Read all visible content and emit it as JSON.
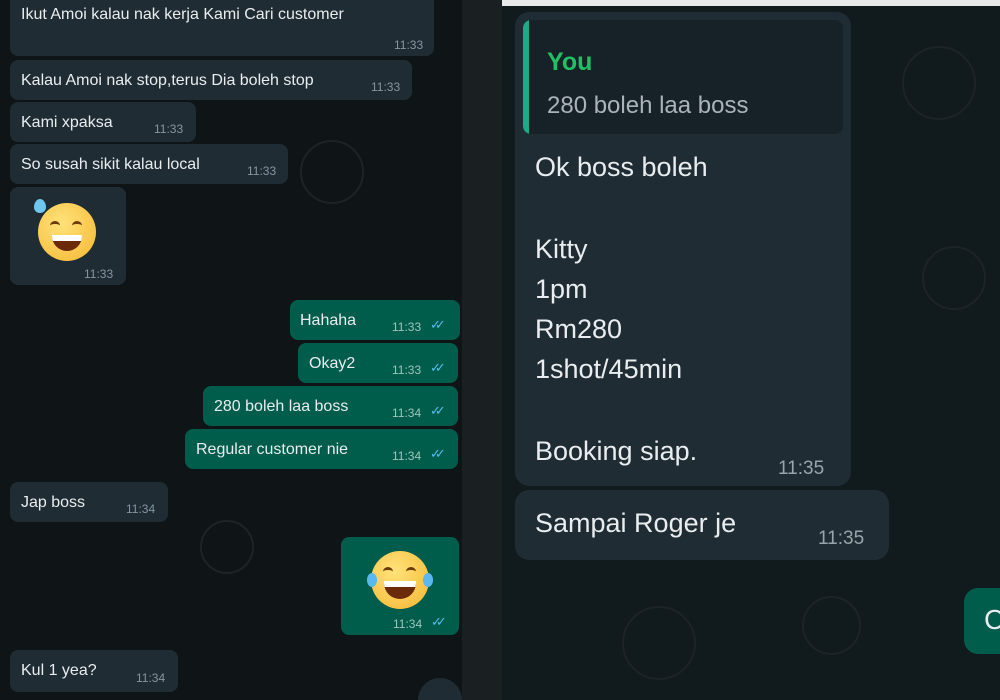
{
  "left_chat": {
    "messages": [
      {
        "text": "Ikut Amoi kalau nak kerja Kami Cari customer",
        "time": "11:33"
      },
      {
        "text": "Kalau Amoi nak stop,terus Dia boleh stop",
        "time": "11:33"
      },
      {
        "text": "Kami xpaksa",
        "time": "11:33"
      },
      {
        "text": "So susah sikit kalau local",
        "time": "11:33"
      },
      {
        "emoji": "sweat-smile-emoji",
        "time": "11:33"
      },
      {
        "text": "Hahaha",
        "time": "11:33"
      },
      {
        "text": "Okay2",
        "time": "11:33"
      },
      {
        "text": "280 boleh laa boss",
        "time": "11:34"
      },
      {
        "text": "Regular customer nie",
        "time": "11:34"
      },
      {
        "text": "Jap boss",
        "time": "11:34"
      },
      {
        "emoji": "tears-of-joy-emoji",
        "time": "11:34"
      },
      {
        "text": "Kul 1 yea?",
        "time": "11:34"
      }
    ],
    "read_ticks": "✓✓"
  },
  "right_chat": {
    "quoted": {
      "author": "You",
      "text": "280 boleh laa boss"
    },
    "reply_lines": [
      "Ok boss boleh",
      "Kitty",
      "1pm",
      "Rm280",
      "1shot/45min",
      "Booking siap."
    ],
    "reply_time": "11:35",
    "second": {
      "text": "Sampai Roger je",
      "time": "11:35"
    },
    "partial_out": "C"
  },
  "colors": {
    "incoming": "#1f2c33",
    "outgoing": "#005c4b",
    "tick_blue": "#53bdeb",
    "quote_green": "#21c063"
  }
}
